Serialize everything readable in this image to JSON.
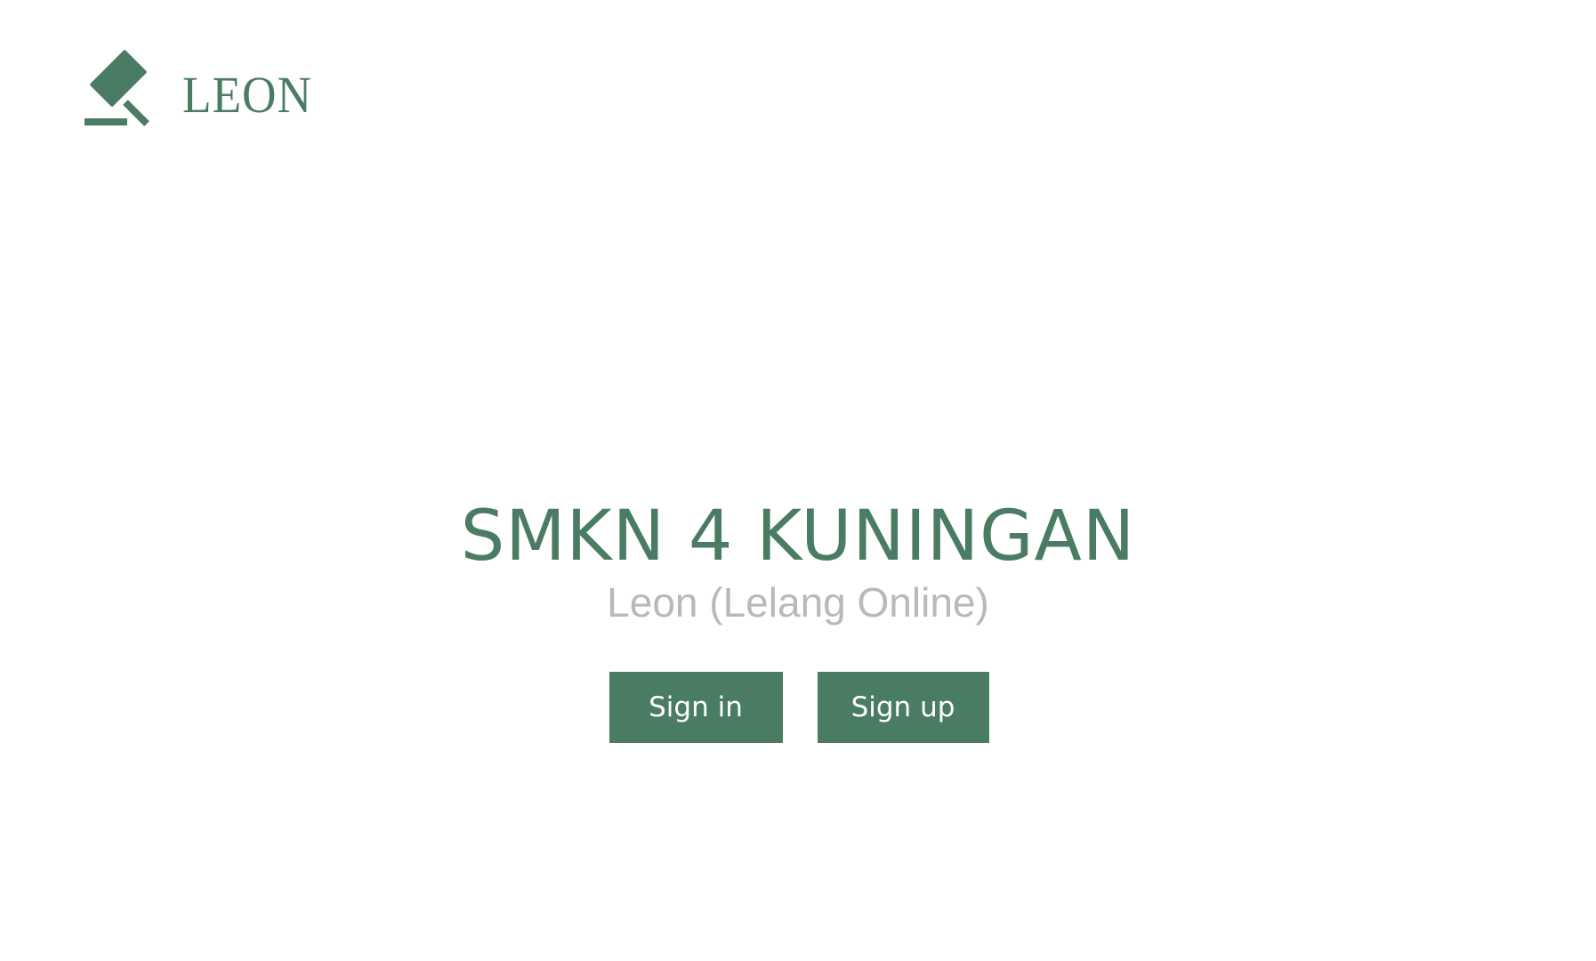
{
  "brand": {
    "logo_icon": "gavel-icon",
    "name": "LEON",
    "color": "#4a7c63"
  },
  "hero": {
    "title": "SMKN 4 KUNINGAN",
    "subtitle": "Leon (Lelang Online)"
  },
  "actions": {
    "signin_label": "Sign in",
    "signup_label": "Sign up"
  },
  "colors": {
    "primary": "#4a7c63",
    "subtitle": "#b9b9b9",
    "button_text": "#ffffff",
    "background": "#ffffff"
  }
}
